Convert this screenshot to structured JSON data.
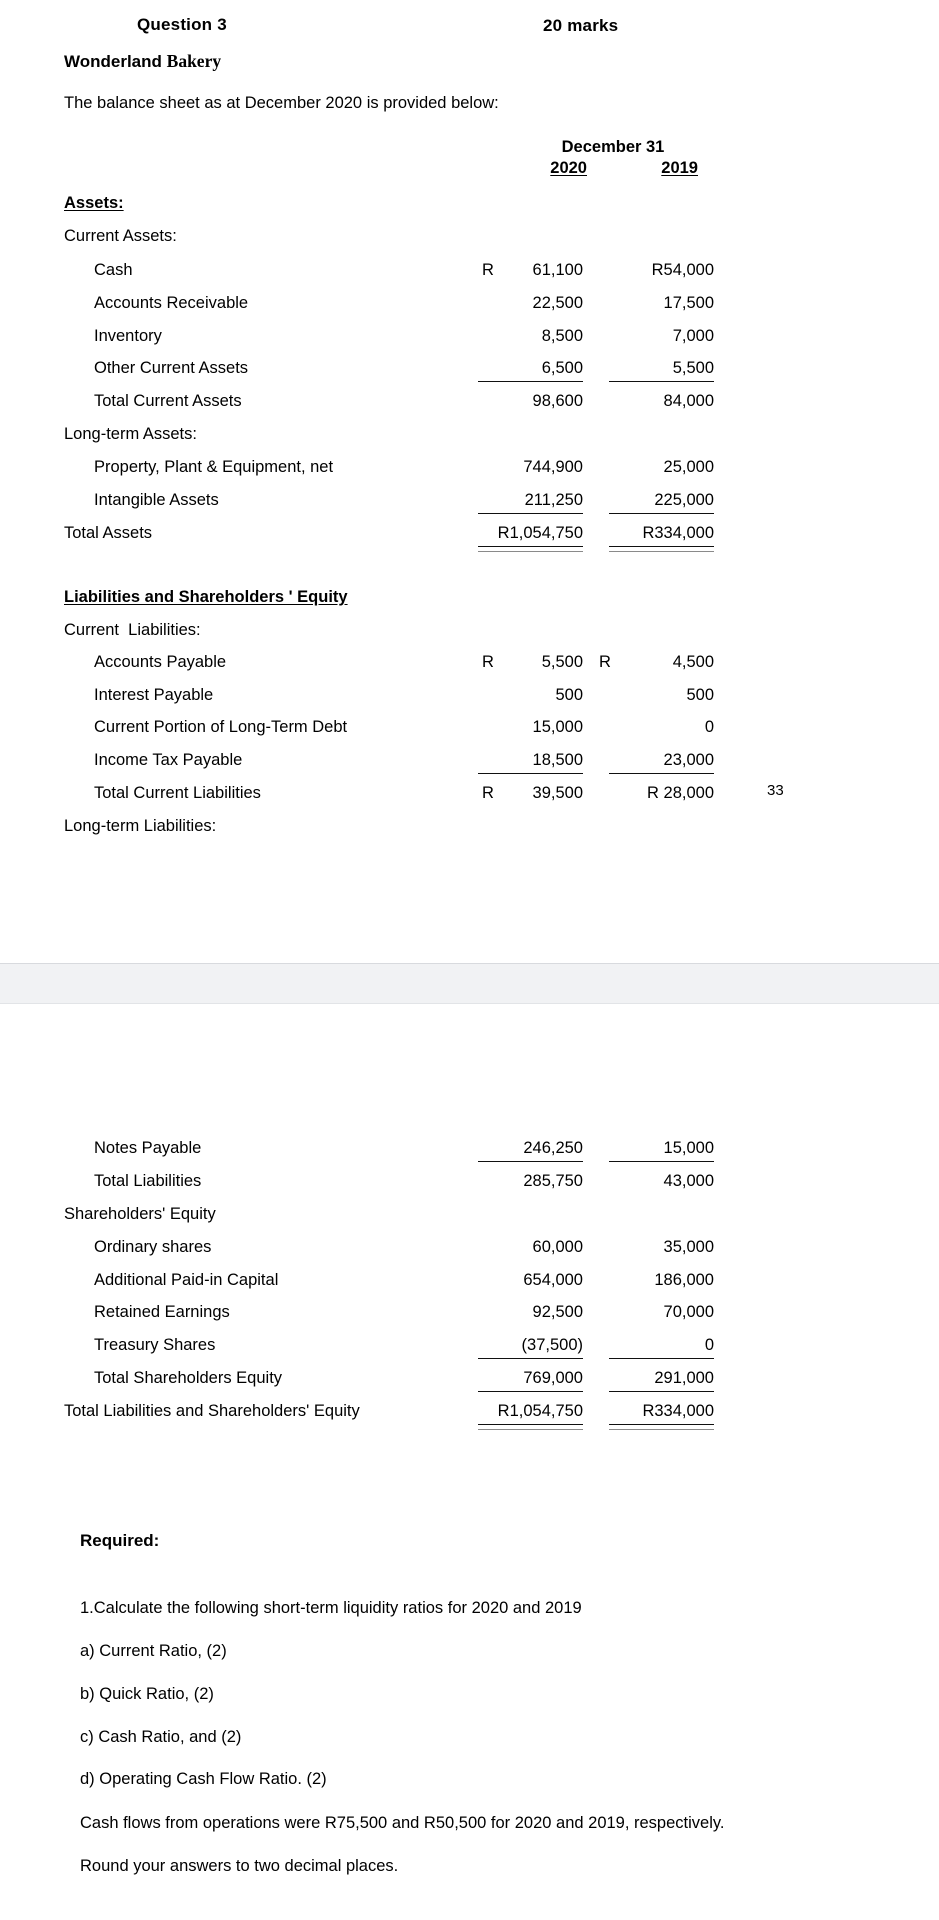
{
  "document": {
    "question_title": "Question 3",
    "marks": "20 marks",
    "company": {
      "word1": "Wonderland",
      "word2": "Bakery"
    },
    "intro": "The balance sheet as at December 2020 is provided below:",
    "page_number": "33"
  },
  "table": {
    "period_header": "December 31",
    "year_2020": "2020",
    "year_2019": "2019",
    "assets_heading": "Assets:",
    "liabilities_heading": "Liabilities and Shareholders ' Equity",
    "sections": {
      "current_assets_heading": "Current Assets:",
      "long_term_assets_heading": "Long-term Assets:",
      "current_liabilities_heading": "Current  Liabilities:",
      "long_term_liabilities_heading": "Long-term Liabilities:",
      "shareholders_equity_heading": "Shareholders' Equity"
    },
    "rows_page1": [
      {
        "label": "Cash",
        "cur2020": "R",
        "v2020": "61,100",
        "cur2019": "",
        "v2019": "R54,000"
      },
      {
        "label": "Accounts Receivable",
        "cur2020": "",
        "v2020": "22,500",
        "cur2019": "",
        "v2019": "17,500"
      },
      {
        "label": "Inventory",
        "cur2020": "",
        "v2020": "8,500",
        "cur2019": "",
        "v2019": "7,000"
      },
      {
        "label": "Other Current Assets",
        "cur2020": "",
        "v2020": "6,500",
        "cur2019": "",
        "v2019": "5,500"
      },
      {
        "label": "Total Current Assets",
        "cur2020": "",
        "v2020": "98,600",
        "cur2019": "",
        "v2019": "84,000"
      },
      {
        "label": "Property, Plant & Equipment, net",
        "cur2020": "",
        "v2020": "744,900",
        "cur2019": "",
        "v2019": "25,000"
      },
      {
        "label": "Intangible Assets",
        "cur2020": "",
        "v2020": "211,250",
        "cur2019": "",
        "v2019": "225,000"
      },
      {
        "label": "Total Assets",
        "cur2020": "",
        "v2020": "R1,054,750",
        "cur2019": "",
        "v2019": "R334,000"
      },
      {
        "label": "Accounts Payable",
        "cur2020": "R",
        "v2020": "5,500",
        "cur2019": "R",
        "v2019": "4,500"
      },
      {
        "label": "Interest Payable",
        "cur2020": "",
        "v2020": "500",
        "cur2019": "",
        "v2019": "500"
      },
      {
        "label": "Current Portion of Long-Term Debt",
        "cur2020": "",
        "v2020": "15,000",
        "cur2019": "",
        "v2019": "0"
      },
      {
        "label": "Income Tax Payable",
        "cur2020": "",
        "v2020": "18,500",
        "cur2019": "",
        "v2019": "23,000"
      },
      {
        "label": "Total Current Liabilities",
        "cur2020": "R",
        "v2020": "39,500",
        "cur2019": "",
        "v2019": "R 28,000"
      }
    ],
    "rows_page2": [
      {
        "label": "Notes Payable",
        "v2020": "246,250",
        "v2019": "15,000"
      },
      {
        "label": "Total Liabilities",
        "v2020": "285,750",
        "v2019": "43,000"
      },
      {
        "label": "Ordinary shares",
        "v2020": "60,000",
        "v2019": "35,000"
      },
      {
        "label": "Additional Paid-in Capital",
        "v2020": "654,000",
        "v2019": "186,000"
      },
      {
        "label": "Retained Earnings",
        "v2020": "92,500",
        "v2019": "70,000"
      },
      {
        "label": "Treasury Shares",
        "v2020": "(37,500)",
        "v2019": "0"
      },
      {
        "label": "Total Shareholders Equity",
        "v2020": "769,000",
        "v2019": "291,000"
      },
      {
        "label": "Total Liabilities and Shareholders' Equity",
        "v2020": "R1,054,750",
        "v2019": "R334,000"
      }
    ]
  },
  "required": {
    "heading": "Required:",
    "item1": "1.Calculate the following short-term liquidity ratios for 2020 and 2019",
    "a": "a) Current Ratio, (2)",
    "b": "b) Quick Ratio, (2)",
    "c": "c) Cash Ratio, and (2)",
    "d": "d) Operating Cash Flow Ratio. (2)",
    "note1": "Cash flows from operations were R75,500 and R50,500 for 2020 and 2019, respectively.",
    "note2": "Round your answers to two decimal places."
  }
}
